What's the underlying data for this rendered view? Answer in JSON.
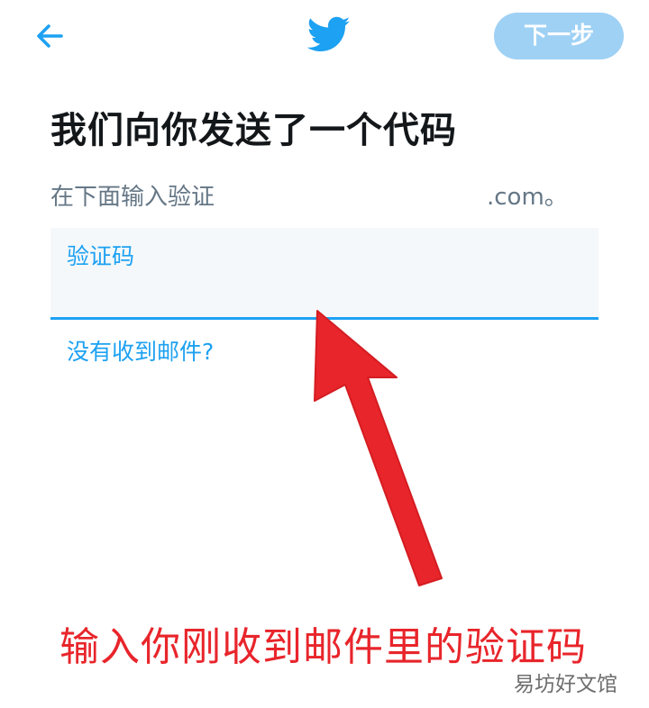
{
  "header": {
    "back_icon": "arrow-left-icon",
    "logo_icon": "twitter-bird-icon",
    "next_label": "下一步"
  },
  "main": {
    "title": "我们向你发送了一个代码",
    "subtitle": "在下面输入验证",
    "subtitle_suffix": ".com。",
    "code_field": {
      "label": "验证码",
      "value": ""
    },
    "resend_link": "没有收到邮件?"
  },
  "overlay": {
    "annotation": "输入你刚收到邮件里的验证码",
    "watermark": "易坊好文馆"
  },
  "colors": {
    "brand_blue": "#1da1f2",
    "button_disabled": "#9fd1f5",
    "annotation_red": "#e8252b"
  }
}
